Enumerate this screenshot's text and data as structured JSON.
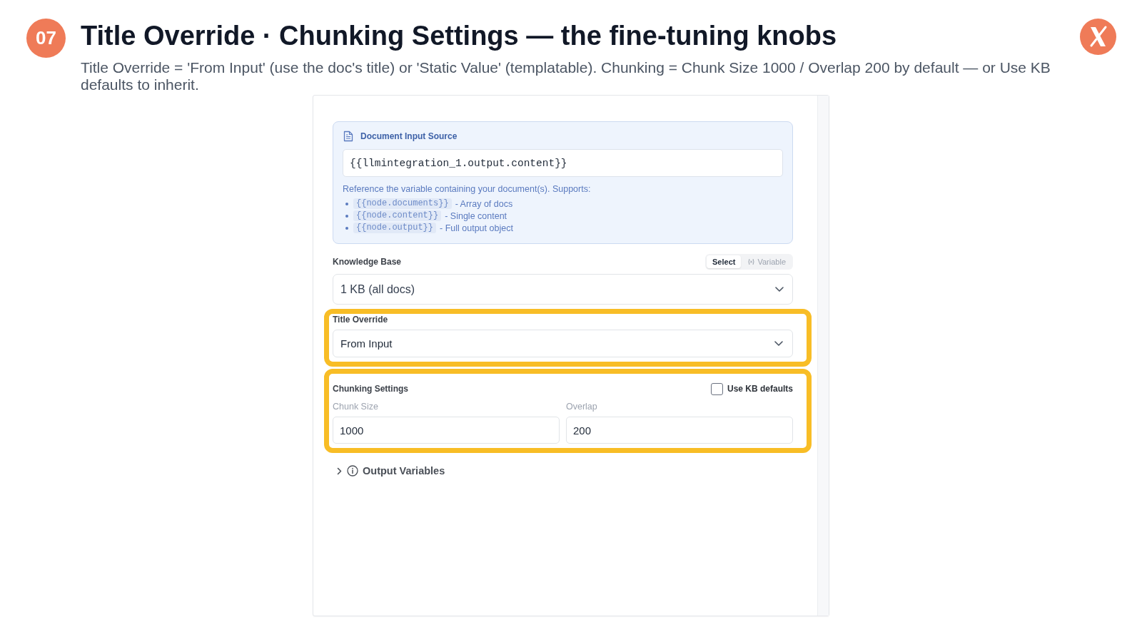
{
  "slide": {
    "number": "07",
    "title": "Title Override · Chunking Settings — the fine-tuning knobs",
    "subtitle": "Title Override = 'From Input' (use the doc's title) or 'Static Value' (templatable). Chunking = Chunk Size 1000 / Overlap 200 by default — or Use KB defaults to inherit."
  },
  "document_input_source": {
    "title": "Document Input Source",
    "value": "{{llmintegration_1.output.content}}",
    "help": "Reference the variable containing your document(s). Supports:",
    "examples": [
      {
        "code": "{{node.documents}}",
        "description": "- Array of docs"
      },
      {
        "code": "{{node.content}}",
        "description": "- Single content"
      },
      {
        "code": "{{node.output}}",
        "description": "- Full output object"
      }
    ]
  },
  "knowledge_base": {
    "label": "Knowledge Base",
    "modes": [
      {
        "label": "Select",
        "selected": true
      },
      {
        "label": "Variable",
        "selected": false
      }
    ],
    "value": "1 KB (all docs)"
  },
  "title_override": {
    "label": "Title Override",
    "value": "From Input",
    "highlighted": true
  },
  "chunking_settings": {
    "label": "Chunking Settings",
    "highlighted": true,
    "use_kb_defaults": {
      "label": "Use KB defaults",
      "checked": false
    },
    "fields": [
      {
        "label": "Chunk Size",
        "value": "1000"
      },
      {
        "label": "Overlap",
        "value": "200"
      }
    ]
  },
  "output_variables": {
    "label": "Output Variables",
    "expanded": false
  }
}
